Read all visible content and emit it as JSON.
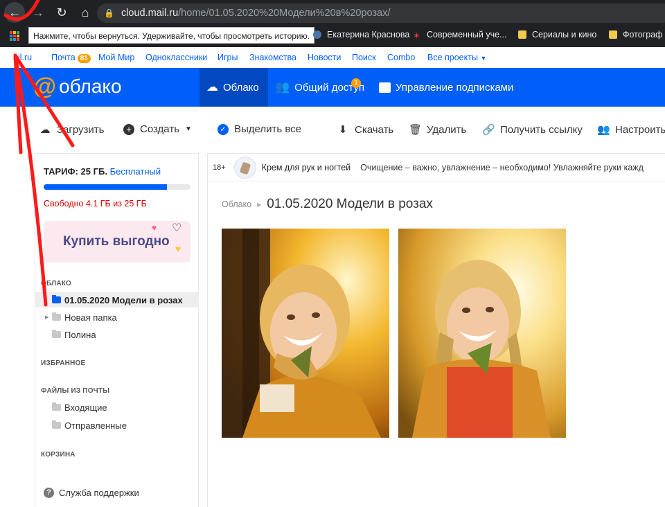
{
  "browser": {
    "url_host": "cloud.mail.ru",
    "url_path": "/home/01.05.2020%20Модели%20в%20розах/",
    "back_tooltip": "Нажмите, чтобы вернуться. Удерживайте, чтобы просмотреть историю.",
    "bookmarks": [
      {
        "label": "Екатерина Краснова"
      },
      {
        "label": "Современный уче..."
      },
      {
        "label": "Сериалы и кино"
      },
      {
        "label": "Фотограф"
      }
    ]
  },
  "portal": {
    "links": [
      {
        "label": "ail.ru"
      },
      {
        "label": "Почта",
        "badge": "81"
      },
      {
        "label": "Мой Мир"
      },
      {
        "label": "Одноклассники"
      },
      {
        "label": "Игры"
      },
      {
        "label": "Знакомства"
      },
      {
        "label": "Новости"
      },
      {
        "label": "Поиск"
      },
      {
        "label": "Combo"
      },
      {
        "label": "Все проекты"
      }
    ]
  },
  "header": {
    "logo_text": "облако",
    "tabs": [
      {
        "label": "Облако"
      },
      {
        "label": "Общий доступ",
        "badge": "1"
      },
      {
        "label": "Управление подписками"
      }
    ]
  },
  "toolbar": {
    "upload": "Загрузить",
    "create": "Создать",
    "select_all": "Выделить все",
    "download": "Скачать",
    "delete": "Удалить",
    "get_link": "Получить ссылку",
    "configure": "Настроить"
  },
  "sidebar": {
    "tariff_label": "ТАРИФ: 25 ГБ.",
    "tariff_plan": "Бесплатный",
    "quota_fraction": 0.84,
    "free_text": "Свободно 4.1 ГБ из 25 ГБ",
    "promo": "Купить выгодно",
    "cloud_header": "ОБЛАКО",
    "folders": [
      {
        "label": "01.05.2020 Модели в розах"
      },
      {
        "label": "Новая папка"
      },
      {
        "label": "Полина"
      }
    ],
    "favorites_header": "ИЗБРАННОЕ",
    "mail_header": "ФАЙЛЫ ИЗ ПОЧТЫ",
    "mail_folders": [
      {
        "label": "Входящие"
      },
      {
        "label": "Отправленные"
      }
    ],
    "trash_header": "КОРЗИНА",
    "support": "Служба поддержки"
  },
  "ad": {
    "age": "18+",
    "title": "Крем для рук и ногтей",
    "text": "Очищение – важно, увлажнение – необходимо! Увлажняйте руки кажд"
  },
  "main": {
    "breadcrumb_root": "Облако",
    "folder_title": "01.05.2020 Модели в розах"
  }
}
